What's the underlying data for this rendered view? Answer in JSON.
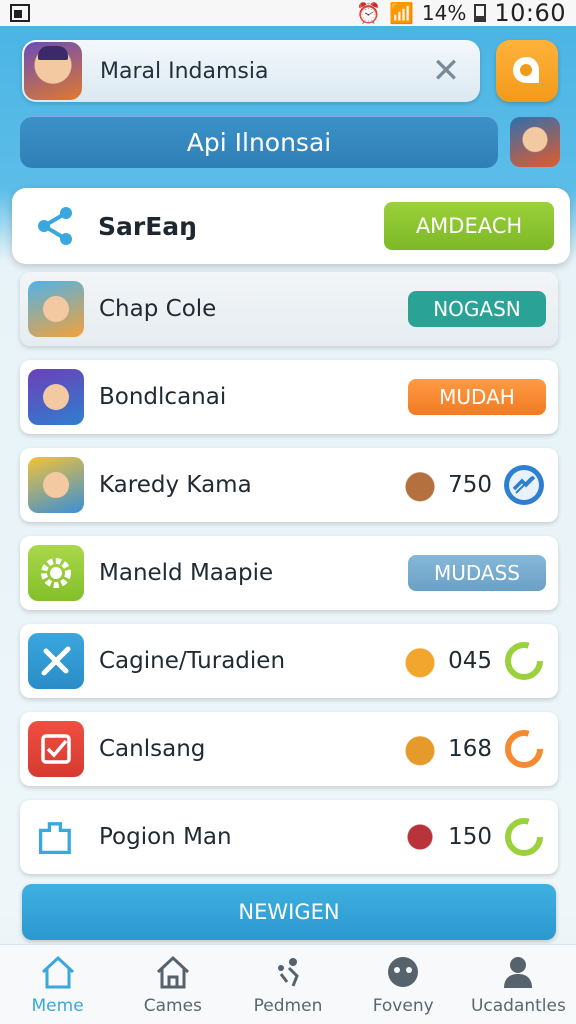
{
  "status_bar": {
    "battery": "14%",
    "time": "10:60"
  },
  "header": {
    "profile_name": "Maral Indamsia",
    "close_glyph": "✕",
    "subtitle": "Api Ilnonsai"
  },
  "share_card": {
    "title": "SarEaŋ",
    "action_label": "AMDEACH",
    "icon": "share-icon"
  },
  "list": {
    "rows": [
      {
        "label": "Chap Cole",
        "pill": "NOGASN",
        "pill_color": "#2aa396"
      },
      {
        "label": "Bondlcanai",
        "pill": "MUDAH",
        "pill_color": "#f58a32"
      },
      {
        "label": "Karedy Kama",
        "score": "750",
        "ring_color": "#2f7fd0"
      },
      {
        "label": "Maneld Maapie",
        "pill": "MUDASS",
        "pill_color": "#6fa6c9"
      },
      {
        "label": "Cagine/Turadien",
        "score": "045",
        "ring_color": "#9ad13c"
      },
      {
        "label": "Canlsang",
        "score": "168",
        "ring_color": "#f58a32"
      },
      {
        "label": "Pogion Man",
        "score": "150",
        "ring_color": "#9ad13c"
      }
    ]
  },
  "bottom_button": {
    "label": "NEWIGEN"
  },
  "nav": {
    "items": [
      {
        "label": "Meme",
        "icon": "home-icon",
        "active": true
      },
      {
        "label": "Cames",
        "icon": "house-icon",
        "active": false
      },
      {
        "label": "Pedmen",
        "icon": "people-icon",
        "active": false
      },
      {
        "label": "Foveny",
        "icon": "face-icon",
        "active": false
      },
      {
        "label": "Ucadantles",
        "icon": "user-icon",
        "active": false
      }
    ]
  },
  "colors": {
    "accent_blue": "#3aa7dd",
    "orange": "#f39a1b",
    "green": "#8cc63f"
  }
}
